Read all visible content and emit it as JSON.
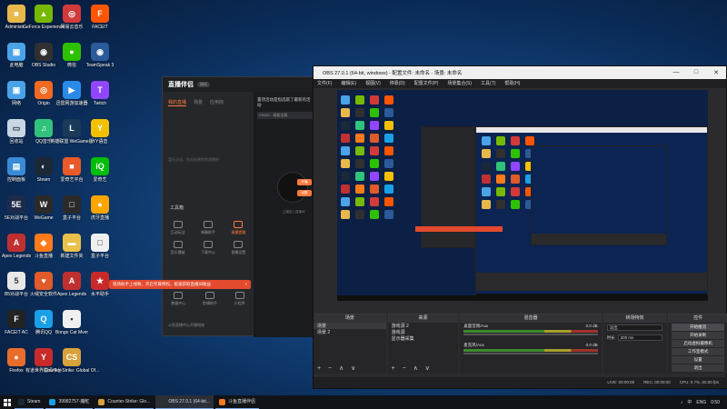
{
  "desktop": {
    "col1": [
      {
        "label": "Administr...",
        "icon": "user-folder-icon",
        "color": "#e8b94a",
        "glyph": "■"
      },
      {
        "label": "此电脑",
        "icon": "computer-icon",
        "color": "#4aa3e8",
        "glyph": "▣"
      },
      {
        "label": "网络",
        "icon": "network-icon",
        "color": "#4aa3e8",
        "glyph": "▣"
      },
      {
        "label": "回收站",
        "icon": "recycle-bin-icon",
        "color": "#c9d6e3",
        "glyph": "▭"
      },
      {
        "label": "控制面板",
        "icon": "control-panel-icon",
        "color": "#3a8ad6",
        "glyph": "▤"
      },
      {
        "label": "5E对战平台",
        "icon": "5e-icon",
        "color": "#1d2b4a",
        "glyph": "5E"
      },
      {
        "label": "Apex Legends",
        "icon": "apex-icon",
        "color": "#c03030",
        "glyph": "A"
      },
      {
        "label": "B5对战平台",
        "icon": "b5-icon",
        "color": "#e8e8e8",
        "glyph": "5"
      },
      {
        "label": "FACEIT AC",
        "icon": "faceit-ac-icon",
        "color": "#222222",
        "glyph": "F"
      },
      {
        "label": "Firefox",
        "icon": "firefox-icon",
        "color": "#e86d2a",
        "glyph": "●"
      }
    ],
    "col2": [
      {
        "label": "GeForce Experience",
        "icon": "geforce-icon",
        "color": "#76b900",
        "glyph": "▲"
      },
      {
        "label": "OBS Studio",
        "icon": "obs-icon",
        "color": "#303030",
        "glyph": "◉"
      },
      {
        "label": "Origin",
        "icon": "origin-icon",
        "color": "#f26a21",
        "glyph": "◎"
      },
      {
        "label": "QQ音乐",
        "icon": "qq-music-icon",
        "color": "#31c27c",
        "glyph": "♫"
      },
      {
        "label": "Steam",
        "icon": "steam-icon",
        "color": "#1b2838",
        "glyph": "◐"
      },
      {
        "label": "WeGame",
        "icon": "wegame-icon",
        "color": "#2a2a2a",
        "glyph": "W"
      },
      {
        "label": "斗鱼直播",
        "icon": "douyu-icon",
        "color": "#ff7a1a",
        "glyph": "◆"
      },
      {
        "label": "火绒安全软件",
        "icon": "huorong-icon",
        "color": "#e05a2a",
        "glyph": "♥"
      },
      {
        "label": "腾讯QQ",
        "icon": "qq-icon",
        "color": "#1aa0e8",
        "glyph": "Q"
      },
      {
        "label": "有道世界翻译平台",
        "icon": "youdao-icon",
        "color": "#c82a2a",
        "glyph": "Y"
      }
    ],
    "col3": [
      {
        "label": "网易云音乐",
        "icon": "netease-music-icon",
        "color": "#d23a3a",
        "glyph": "◎"
      },
      {
        "label": "微信",
        "icon": "wechat-icon",
        "color": "#2dc100",
        "glyph": "●"
      },
      {
        "label": "迅雷网游加速器",
        "icon": "xunlei-icon",
        "color": "#2a8ae8",
        "glyph": "▶"
      },
      {
        "label": "英雄联盟 WeGame版",
        "icon": "lol-icon",
        "color": "#1a3a5a",
        "glyph": "L"
      },
      {
        "label": "爱奇艺平台",
        "icon": "tencent-game-icon",
        "color": "#e85a2a",
        "glyph": "■"
      },
      {
        "label": "盒子平台",
        "icon": "box-platform-icon",
        "color": "#2a2a2a",
        "glyph": "□"
      },
      {
        "label": "新建文件夹",
        "icon": "folder-icon",
        "color": "#e8c04a",
        "glyph": "▬"
      },
      {
        "label": "Apex Legends",
        "icon": "apex-icon-2",
        "color": "#c03030",
        "glyph": "A"
      },
      {
        "label": "Bongo Cat Mver",
        "icon": "bongo-cat-icon",
        "color": "#f0f0f0",
        "glyph": "•"
      },
      {
        "label": "Counter-Strike: Global Of...",
        "icon": "csgo-icon",
        "color": "#d8a23a",
        "glyph": "CS"
      }
    ],
    "col4": [
      {
        "label": "FACEIT",
        "icon": "faceit-icon",
        "color": "#ff5500",
        "glyph": "F"
      },
      {
        "label": "TeamSpeak 3",
        "icon": "teamspeak-icon",
        "color": "#2a5a9a",
        "glyph": "◉"
      },
      {
        "label": "Twitch",
        "icon": "twitch-icon",
        "color": "#9146ff",
        "glyph": "T"
      },
      {
        "label": "YY语音",
        "icon": "yy-icon",
        "color": "#f5c000",
        "glyph": "Y"
      },
      {
        "label": "爱奇艺",
        "icon": "iqiyi-icon",
        "color": "#00be06",
        "glyph": "iQ"
      },
      {
        "label": "虎牙直播",
        "icon": "huya-icon",
        "color": "#ffa500",
        "glyph": "●"
      },
      {
        "label": "盒子平台",
        "icon": "box-icon",
        "color": "#f0f0f0",
        "glyph": "□"
      },
      {
        "label": "水平助手",
        "icon": "assistant-icon",
        "color": "#c82a2a",
        "glyph": "★"
      }
    ]
  },
  "live_app": {
    "logo": "直播伴侣",
    "version": "测试",
    "tabs": [
      "我的直播",
      "场景",
      "应用商"
    ],
    "plus": "+",
    "empty_hint": "暂无活动，快去创建你的直播吧",
    "tools_title": "工具箱",
    "tools_row1": [
      "互动玩法",
      "弹幕助手",
      "直播提醒"
    ],
    "tools_row2": [
      "音乐播放",
      "下载中心",
      "直播设置"
    ],
    "tools_row3": [
      "数据中心",
      "剪辑助手",
      "小程序"
    ],
    "footer": "斗鱼直播中心开播指南",
    "side_header": "置顶活动是指选取了最新的活动",
    "side_select": "CSGO - 轻松全局",
    "side_btn1": "开播",
    "side_btn2": "设置",
    "side_hint": "主播进入直播间"
  },
  "toast": {
    "text": "现场助手上线啦，开启专属特权，极速获取直播间收益",
    "close": "×"
  },
  "obs": {
    "title": "OBS 27.0.1 (64-bit, windows) - 配置文件: 未命名 - 场景: 未命名",
    "window_controls": [
      "—",
      "□",
      "✕"
    ],
    "menu": [
      "文件(F)",
      "编辑(E)",
      "视图(V)",
      "停靠(D)",
      "配置文件(P)",
      "场景集合(S)",
      "工具(T)",
      "帮助(H)"
    ],
    "scenes": {
      "title": "场景",
      "items": [
        "场景",
        "场景 2"
      ]
    },
    "sources": {
      "title": "来源",
      "items": [
        "游戏源 2",
        "游戏源",
        "显示器采集"
      ]
    },
    "dock_controls": "+ − ∧ ∨",
    "mixer": {
      "title": "混音器",
      "tracks": [
        {
          "name": "桌面音频/Aux",
          "db": "0.0 dB"
        },
        {
          "name": "麦克风/Aux",
          "db": "0.0 dB"
        }
      ]
    },
    "transitions": {
      "title": "转场特效",
      "fade": "淡出",
      "duration_label": "时长",
      "duration_value": "300 ms"
    },
    "controls": {
      "title": "控件",
      "buttons": [
        "开始推流",
        "开始录制",
        "启动虚拟摄像机",
        "工作室模式",
        "设置",
        "退出"
      ]
    },
    "status": {
      "live": "LIVE: 00:00:00",
      "rec": "REC: 00:00:00",
      "cpu": "CPU: 0.7%, 60.00 fps"
    }
  },
  "taskbar": {
    "items": [
      {
        "label": "Steam",
        "color": "#1b2838"
      },
      {
        "label": "39982757-魔魟",
        "color": "#1aa0e8"
      },
      {
        "label": "Counter-Strike: Glo...",
        "color": "#d8a23a"
      },
      {
        "label": "OBS 27.0.1 (64-bit...",
        "color": "#303030"
      },
      {
        "label": "斗鱼直播伴侣",
        "color": "#ff7a1a"
      }
    ],
    "lang": "ENG",
    "ime": "中",
    "time": "0:50"
  }
}
